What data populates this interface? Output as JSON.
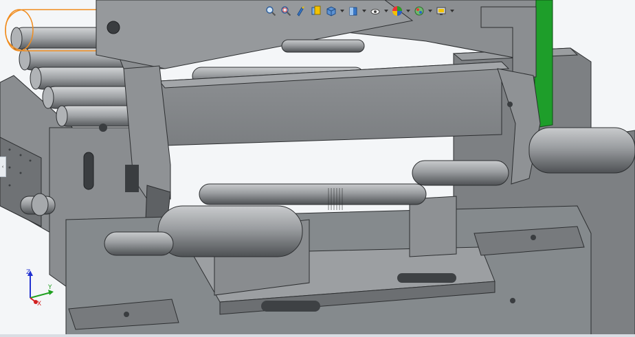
{
  "viewport": {
    "background": "#f4f6f8",
    "model_fill": "#8c8f92",
    "model_dark": "#5a5d60",
    "model_light": "#b4b7ba",
    "highlight_color": "#f08c1e",
    "green_part_color": "#1e9e2a"
  },
  "heads_up_toolbar": {
    "buttons": [
      {
        "icon": "zoom-to-fit-icon"
      },
      {
        "icon": "zoom-to-area-icon"
      },
      {
        "icon": "previous-view-icon"
      },
      {
        "icon": "section-view-icon"
      },
      {
        "icon": "view-orientation-icon",
        "has_dropdown": true
      },
      {
        "icon": "display-style-icon",
        "has_dropdown": true
      },
      {
        "icon": "hide-show-items-icon",
        "has_dropdown": true
      },
      {
        "icon": "edit-appearance-icon",
        "has_dropdown": true
      },
      {
        "icon": "apply-scene-icon",
        "has_dropdown": true
      },
      {
        "icon": "view-settings-icon",
        "has_dropdown": true
      }
    ]
  },
  "triad": {
    "x_label": "X",
    "y_label": "Y",
    "z_label": "Z",
    "x_color": "#d22020",
    "y_color": "#20a020",
    "z_color": "#2030d0"
  },
  "left_panel_toggle": {
    "icon": "expand-panel-icon",
    "glyph": "‹"
  }
}
